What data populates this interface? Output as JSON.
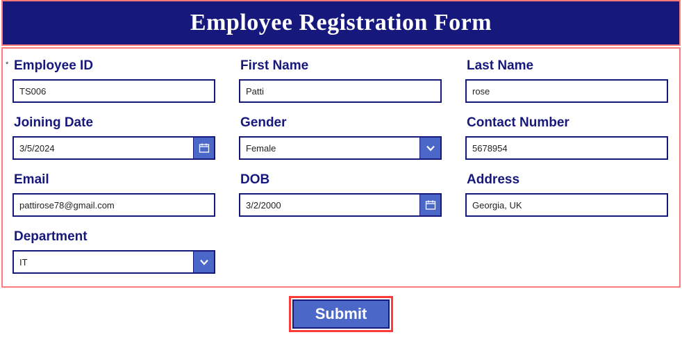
{
  "header": {
    "title": "Employee Registration Form"
  },
  "fields": {
    "employee_id": {
      "label": "Employee ID",
      "value": "TS006"
    },
    "first_name": {
      "label": "First Name",
      "value": "Patti"
    },
    "last_name": {
      "label": "Last Name",
      "value": "rose"
    },
    "joining_date": {
      "label": "Joining Date",
      "value": "3/5/2024"
    },
    "gender": {
      "label": "Gender",
      "value": "Female"
    },
    "contact_number": {
      "label": "Contact Number",
      "value": "5678954"
    },
    "email": {
      "label": "Email",
      "value": "pattirose78@gmail.com"
    },
    "dob": {
      "label": "DOB",
      "value": "3/2/2000"
    },
    "address": {
      "label": "Address",
      "value": "Georgia, UK"
    },
    "department": {
      "label": "Department",
      "value": "IT"
    }
  },
  "actions": {
    "submit": "Submit"
  },
  "colors": {
    "primary": "#17187c",
    "accent": "#4b67c7",
    "highlight": "#ff3a3a"
  }
}
